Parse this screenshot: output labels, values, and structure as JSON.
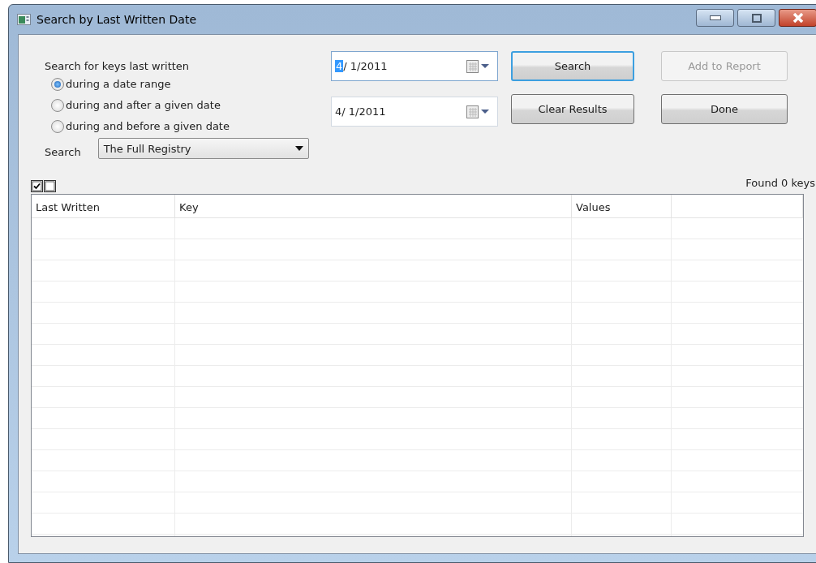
{
  "window": {
    "title": "Search by Last Written Date"
  },
  "search_options": {
    "label": "Search for keys last written",
    "radios": [
      {
        "label": "during a date range",
        "selected": true
      },
      {
        "label": "during and after a given date",
        "selected": false
      },
      {
        "label": "during and before a given date",
        "selected": false
      }
    ]
  },
  "scope": {
    "label": "Search",
    "value": "The Full Registry"
  },
  "date_fields": [
    {
      "highlighted": "4",
      "rest": "/ 1/2011",
      "focused": true
    },
    {
      "rest": "4/ 1/2011",
      "focused": false
    }
  ],
  "buttons": [
    {
      "label": "Search",
      "focused": true,
      "disabled": false
    },
    {
      "label": "Add to Report",
      "focused": false,
      "disabled": true
    },
    {
      "label": "Clear Results",
      "focused": false,
      "disabled": false
    },
    {
      "label": "Done",
      "focused": false,
      "disabled": false
    }
  ],
  "status": "Found 0 keys",
  "table": {
    "columns": [
      "Last Written",
      "Key",
      "Values",
      ""
    ]
  }
}
